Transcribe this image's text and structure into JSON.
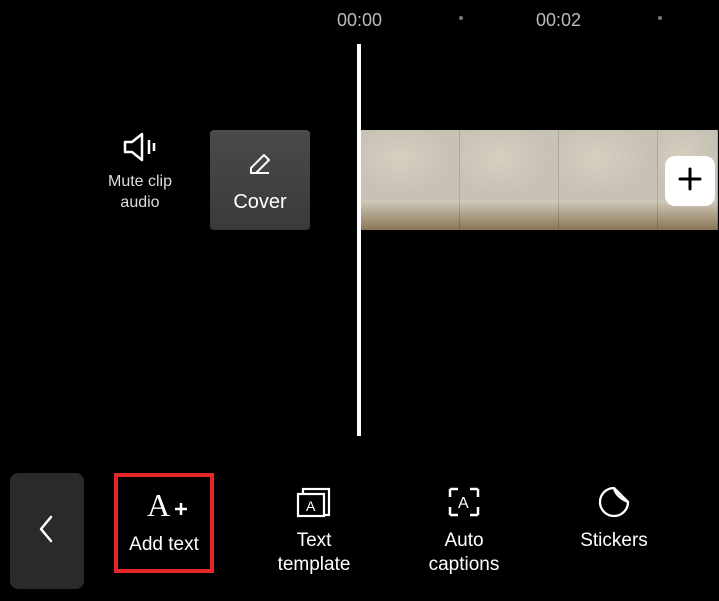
{
  "timeline": {
    "markers": [
      "00:00",
      "00:02"
    ]
  },
  "controls": {
    "mute_label": "Mute clip audio",
    "cover_label": "Cover"
  },
  "toolbar": {
    "add_text": "Add text",
    "text_template": "Text\ntemplate",
    "auto_captions": "Auto\ncaptions",
    "stickers": "Stickers"
  }
}
